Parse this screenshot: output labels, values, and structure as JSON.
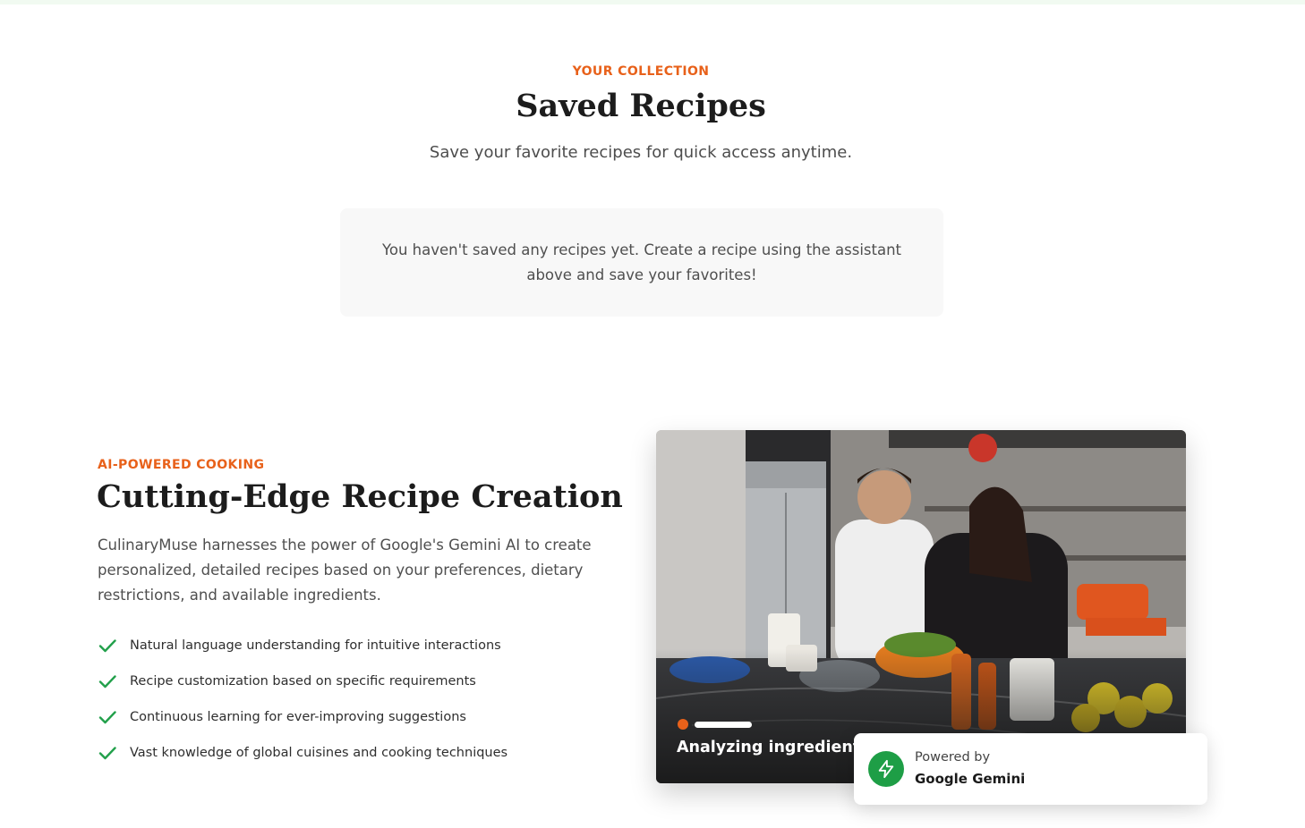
{
  "saved": {
    "eyebrow": "YOUR COLLECTION",
    "title": "Saved Recipes",
    "subtitle": "Save your favorite recipes for quick access anytime.",
    "empty_message": "You haven't saved any recipes yet. Create a recipe using the assistant above and save your favorites!"
  },
  "ai_section": {
    "eyebrow": "AI-POWERED COOKING",
    "title": "Cutting-Edge Recipe Creation",
    "description": "CulinaryMuse harnesses the power of Google's Gemini AI to create personalized, detailed recipes based on your preferences, dietary restrictions, and available ingredients.",
    "features": [
      "Natural language understanding for intuitive interactions",
      "Recipe customization based on specific requirements",
      "Continuous learning for ever-improving suggestions",
      "Vast knowledge of global cuisines and cooking techniques"
    ],
    "feature_icon": "check-icon"
  },
  "image_card": {
    "image": "kitchen-photo",
    "status": "Analyzing ingredients..."
  },
  "badge": {
    "line1": "Powered by",
    "line2": "Google Gemini",
    "icon": "lightning-icon"
  },
  "colors": {
    "accent": "#e8611a",
    "check": "#22a04b",
    "badge_icon_bg": "#1e9e46"
  }
}
